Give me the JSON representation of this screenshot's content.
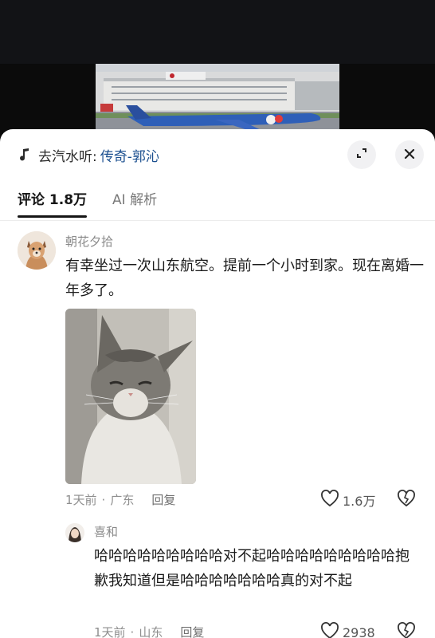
{
  "music": {
    "prefix": "去汽水听:",
    "title": "传奇-郭沁",
    "icon": "music-note-icon"
  },
  "controls": {
    "expand_icon": "expand-icon",
    "close_icon": "close-icon"
  },
  "tabs": [
    {
      "label": "评论 1.8万",
      "active": true
    },
    {
      "label": "AI 解析",
      "active": false
    }
  ],
  "comments": [
    {
      "author": "朝花夕拾",
      "text": "有幸坐过一次山东航空。提前一个小时到家。现在离婚一年多了。",
      "has_image": true,
      "time": "1天前",
      "location": "广东",
      "reply_label": "回复",
      "likes": "1.6万",
      "replies": [
        {
          "author": "喜和",
          "text": "哈哈哈哈哈哈哈哈哈对不起哈哈哈哈哈哈哈哈哈抱歉我知道但是哈哈哈哈哈哈哈真的对不起",
          "time": "1天前",
          "location": "山东",
          "reply_label": "回复",
          "likes": "2938"
        }
      ]
    }
  ],
  "separator": "·",
  "colors": {
    "link_blue": "#1b4f8f",
    "meta_gray": "#8e8e8e",
    "text": "#1a1a1a"
  }
}
